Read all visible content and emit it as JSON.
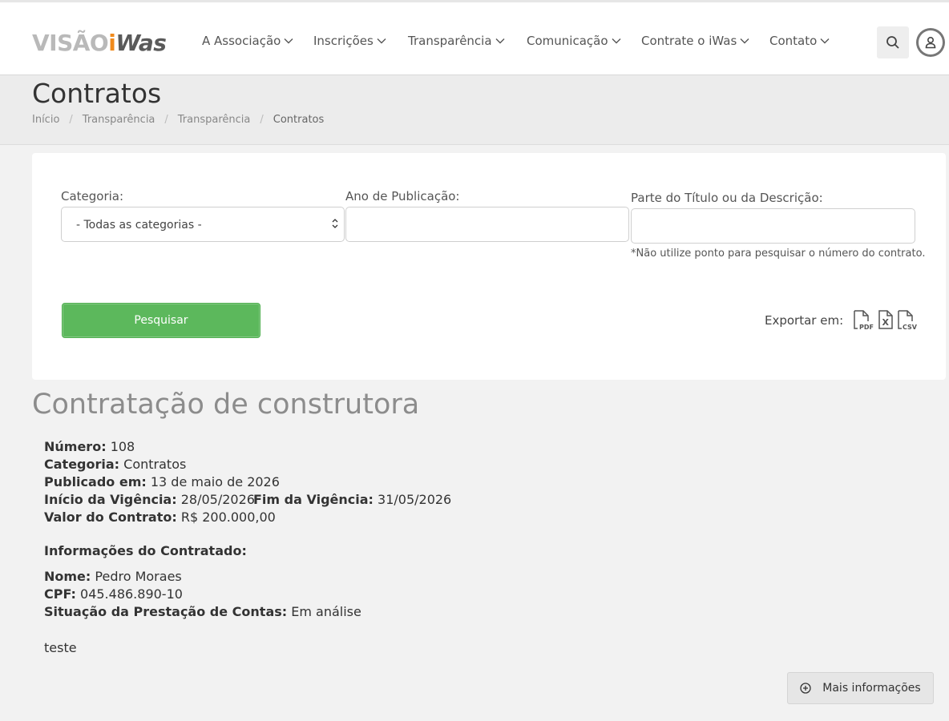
{
  "brand": {
    "logo_part1": "VISÃO",
    "logo_part2": "i",
    "logo_part3": "Was",
    "colors": {
      "gray": "#b9b9b9",
      "orange": "#f08a1c",
      "dark": "#5a5a5a"
    }
  },
  "nav": {
    "items": [
      {
        "label": "A Associação"
      },
      {
        "label": "Inscrições"
      },
      {
        "label": "Transparência"
      },
      {
        "label": "Comunicação"
      },
      {
        "label": "Contrate o iWas"
      },
      {
        "label": "Contato"
      }
    ],
    "search_icon": "search-icon",
    "user_icon": "user-icon"
  },
  "header": {
    "title": "Contratos",
    "breadcrumb": [
      "Início",
      "Transparência",
      "Transparência",
      "Contratos"
    ]
  },
  "filters": {
    "category_label": "Categoria:",
    "category_value": "- Todas as categorias -",
    "year_label": "Ano de Publicação:",
    "year_value": "",
    "text_label": "Parte do Título ou da Descrição:",
    "text_value": "",
    "hint": "*Não utilize ponto para pesquisar o número do contrato.",
    "search_button": "Pesquisar",
    "export_label": "Exportar em:",
    "export_formats": [
      "PDF",
      "X",
      "CSV"
    ],
    "accent_color": "#5cb85c"
  },
  "contract": {
    "title": "Contratação de construtora",
    "numero_label": "Número:",
    "numero": "108",
    "categoria_label": "Categoria:",
    "categoria": "Contratos",
    "publicado_label": "Publicado em:",
    "publicado": "13 de maio de 2026",
    "inicio_label": "Início da Vigência:",
    "inicio": "28/05/2026",
    "fim_label": "Fim da Vigência:",
    "fim": "31/05/2026",
    "valor_label": "Valor do Contrato:",
    "valor": "R$ 200.000,00",
    "contratado_heading": "Informações do Contratado:",
    "nome_label": "Nome:",
    "nome": "Pedro Moraes",
    "cpf_label": "CPF:",
    "cpf": "045.486.890-10",
    "situacao_label": "Situação da Prestação de Contas:",
    "situacao": "Em análise",
    "descricao": "teste"
  },
  "more_button": "Mais informações"
}
